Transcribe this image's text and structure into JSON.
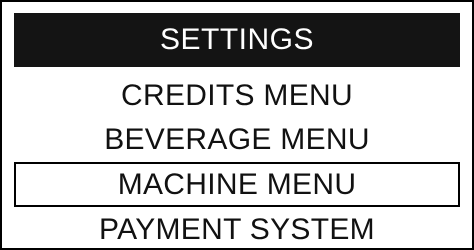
{
  "screen": {
    "title": "SETTINGS",
    "menu_items": [
      {
        "label": "CREDITS MENU",
        "selected": false
      },
      {
        "label": "BEVERAGE MENU",
        "selected": false
      },
      {
        "label": "MACHINE MENU",
        "selected": true
      },
      {
        "label": "PAYMENT SYSTEM",
        "selected": false
      }
    ]
  }
}
